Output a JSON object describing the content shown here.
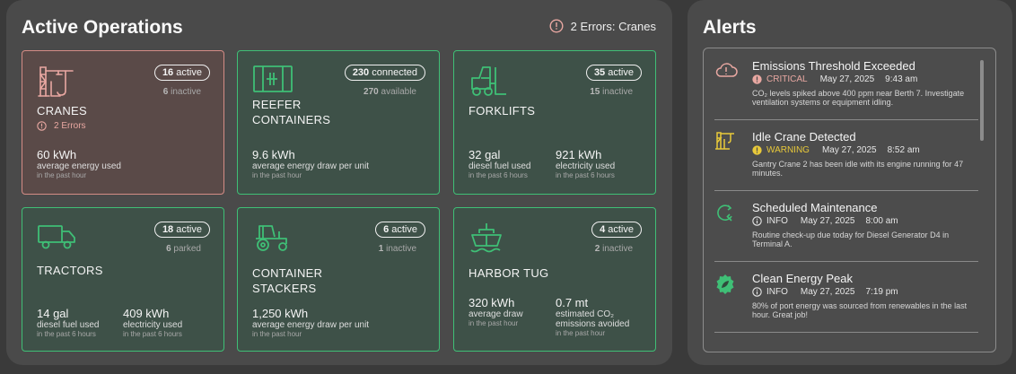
{
  "operations": {
    "title": "Active Operations",
    "error_summary": "2 Errors: Cranes",
    "cards": [
      {
        "name_line1": "CRANES",
        "name_line2": "",
        "pill_count": "16",
        "pill_label": "active",
        "sub_count": "6",
        "sub_label": "inactive",
        "error_text": "2 Errors",
        "metric1": {
          "value": "60 kWh",
          "label": "average energy used",
          "time": "in the past hour"
        }
      },
      {
        "name_line1": "REEFER",
        "name_line2": "CONTAINERS",
        "pill_count": "230",
        "pill_label": "connected",
        "sub_count": "270",
        "sub_label": "available",
        "metric1": {
          "value": "9.6 kWh",
          "label": "average energy draw per unit",
          "time": "in the past hour"
        }
      },
      {
        "name_line1": "FORKLIFTS",
        "name_line2": "",
        "pill_count": "35",
        "pill_label": "active",
        "sub_count": "15",
        "sub_label": "inactive",
        "metric1": {
          "value": "32 gal",
          "label": "diesel fuel used",
          "time": "in the past 6 hours"
        },
        "metric2": {
          "value": "921 kWh",
          "label": "electricity used",
          "time": "in the past 6 hours"
        }
      },
      {
        "name_line1": "TRACTORS",
        "name_line2": "",
        "pill_count": "18",
        "pill_label": "active",
        "sub_count": "6",
        "sub_label": "parked",
        "metric1": {
          "value": "14 gal",
          "label": "diesel fuel used",
          "time": "in the past 6 hours"
        },
        "metric2": {
          "value": "409 kWh",
          "label": "electricity used",
          "time": "in the past 6 hours"
        }
      },
      {
        "name_line1": "CONTAINER",
        "name_line2": "STACKERS",
        "pill_count": "6",
        "pill_label": "active",
        "sub_count": "1",
        "sub_label": "inactive",
        "metric1": {
          "value": "1,250 kWh",
          "label": "average energy draw per unit",
          "time": "in the past hour"
        }
      },
      {
        "name_line1": "HARBOR TUG",
        "name_line2": "",
        "pill_count": "4",
        "pill_label": "active",
        "sub_count": "2",
        "sub_label": "inactive",
        "metric1": {
          "value": "320 kWh",
          "label": "average draw",
          "time": "in the past hour"
        },
        "metric2": {
          "value": "0.7 mt",
          "label_line1": "estimated CO₂",
          "label_line2": "emissions avoided",
          "time": "in the past hour"
        }
      }
    ]
  },
  "alerts": {
    "title": "Alerts",
    "items": [
      {
        "title": "Emissions Threshold Exceeded",
        "severity": "CRITICAL",
        "date": "May 27, 2025",
        "time": "9:43 am",
        "description": "CO₂ levels spiked above 400 ppm near Berth 7. Investigate ventilation systems or equipment idling."
      },
      {
        "title": "Idle Crane Detected",
        "severity": "WARNING",
        "date": "May 27, 2025",
        "time": "8:52 am",
        "description": "Gantry Crane 2 has been idle with its engine running for 47 minutes."
      },
      {
        "title": "Scheduled Maintenance",
        "severity": "INFO",
        "date": "May 27, 2025",
        "time": "8:00 am",
        "description": "Routine check-up due today for Diesel Generator D4 in Terminal A."
      },
      {
        "title": "Clean Energy Peak",
        "severity": "INFO",
        "date": "May 27, 2025",
        "time": "7:19 pm",
        "description": "80% of port energy was sourced from renewables in the last hour. Great job!"
      }
    ]
  },
  "colors": {
    "accent_green": "#3fbf76",
    "error_red": "#e9a8a2",
    "warning_yellow": "#e8c93a"
  }
}
